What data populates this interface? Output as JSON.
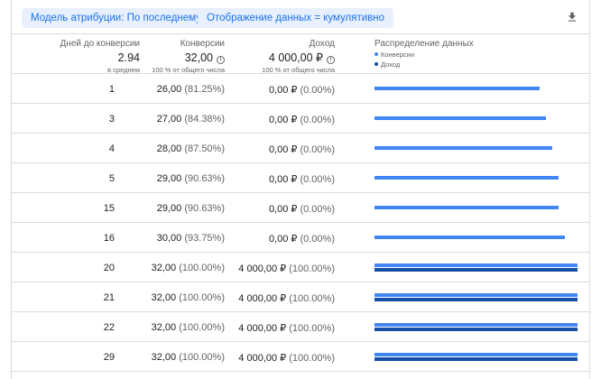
{
  "toolbar": {
    "attribution_chip": "Модель атрибуции: По последнему клику",
    "display_chip": "Отображение данных = кумулятивно",
    "download_icon": "download-icon"
  },
  "header": {
    "days": {
      "label": "Дней до конверсии",
      "value": "2.94",
      "sub": "в среднем"
    },
    "conversions": {
      "label": "Конверсии",
      "value": "32,00",
      "sub": "100 % от общего числа"
    },
    "revenue": {
      "label": "Доход",
      "value": "4 000,00 ₽",
      "sub": "100 % от общего числа"
    },
    "distribution": {
      "label": "Распределение данных",
      "legend": [
        {
          "label": "Конверсии",
          "color": "#4285f4"
        },
        {
          "label": "Доход",
          "color": "#174ea6"
        }
      ]
    }
  },
  "rows": [
    {
      "days": "1",
      "conv": "26,00",
      "conv_pct": "(81.25%)",
      "rev": "0,00 ₽",
      "rev_pct": "(0.00%)",
      "conv_share": 0.8125,
      "rev_share": 0
    },
    {
      "days": "3",
      "conv": "27,00",
      "conv_pct": "(84.38%)",
      "rev": "0,00 ₽",
      "rev_pct": "(0.00%)",
      "conv_share": 0.8438,
      "rev_share": 0
    },
    {
      "days": "4",
      "conv": "28,00",
      "conv_pct": "(87.50%)",
      "rev": "0,00 ₽",
      "rev_pct": "(0.00%)",
      "conv_share": 0.875,
      "rev_share": 0
    },
    {
      "days": "5",
      "conv": "29,00",
      "conv_pct": "(90.63%)",
      "rev": "0,00 ₽",
      "rev_pct": "(0.00%)",
      "conv_share": 0.9063,
      "rev_share": 0
    },
    {
      "days": "15",
      "conv": "29,00",
      "conv_pct": "(90.63%)",
      "rev": "0,00 ₽",
      "rev_pct": "(0.00%)",
      "conv_share": 0.9063,
      "rev_share": 0
    },
    {
      "days": "16",
      "conv": "30,00",
      "conv_pct": "(93.75%)",
      "rev": "0,00 ₽",
      "rev_pct": "(0.00%)",
      "conv_share": 0.9375,
      "rev_share": 0
    },
    {
      "days": "20",
      "conv": "32,00",
      "conv_pct": "(100.00%)",
      "rev": "4 000,00 ₽",
      "rev_pct": "(100.00%)",
      "conv_share": 1,
      "rev_share": 1
    },
    {
      "days": "21",
      "conv": "32,00",
      "conv_pct": "(100.00%)",
      "rev": "4 000,00 ₽",
      "rev_pct": "(100.00%)",
      "conv_share": 1,
      "rev_share": 1
    },
    {
      "days": "22",
      "conv": "32,00",
      "conv_pct": "(100.00%)",
      "rev": "4 000,00 ₽",
      "rev_pct": "(100.00%)",
      "conv_share": 1,
      "rev_share": 1
    },
    {
      "days": "29",
      "conv": "32,00",
      "conv_pct": "(100.00%)",
      "rev": "4 000,00 ₽",
      "rev_pct": "(100.00%)",
      "conv_share": 1,
      "rev_share": 1
    }
  ]
}
